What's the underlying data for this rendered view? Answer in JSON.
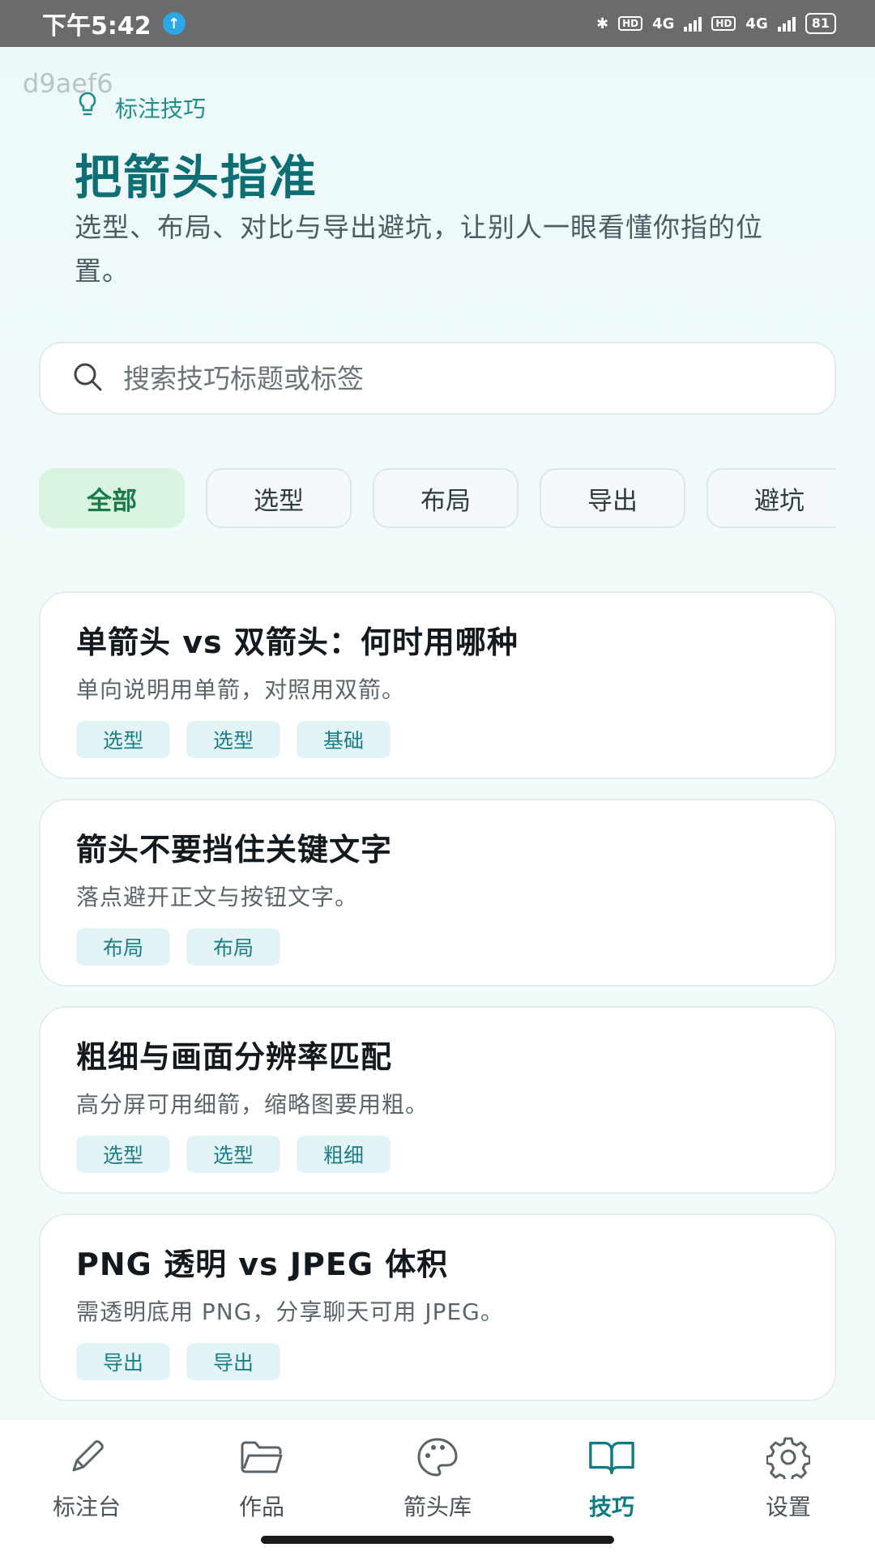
{
  "status_bar": {
    "time": "下午5:42",
    "network_1": "4G",
    "network_2": "4G",
    "hd_label": "HD",
    "battery": "81"
  },
  "watermark": "d9aef6",
  "header": {
    "section_label": "标注技巧",
    "title": "把箭头指准",
    "subtitle": "选型、布局、对比与导出避坑，让别人一眼看懂你指的位置。"
  },
  "search": {
    "placeholder": "搜索技巧标题或标签"
  },
  "filters": [
    {
      "label": "全部",
      "active": true
    },
    {
      "label": "选型",
      "active": false
    },
    {
      "label": "布局",
      "active": false
    },
    {
      "label": "导出",
      "active": false
    },
    {
      "label": "避坑",
      "active": false
    }
  ],
  "cards": [
    {
      "title": "单箭头 vs 双箭头：何时用哪种",
      "desc": "单向说明用单箭，对照用双箭。",
      "tags": [
        "选型",
        "选型",
        "基础"
      ]
    },
    {
      "title": "箭头不要挡住关键文字",
      "desc": "落点避开正文与按钮文字。",
      "tags": [
        "布局",
        "布局"
      ]
    },
    {
      "title": "粗细与画面分辨率匹配",
      "desc": "高分屏可用细箭，缩略图要用粗。",
      "tags": [
        "选型",
        "选型",
        "粗细"
      ]
    },
    {
      "title": "PNG 透明 vs JPEG 体积",
      "desc": "需透明底用 PNG，分享聊天可用 JPEG。",
      "tags": [
        "导出",
        "导出"
      ]
    }
  ],
  "nav": [
    {
      "label": "标注台",
      "icon": "pencil-icon",
      "active": false
    },
    {
      "label": "作品",
      "icon": "folder-icon",
      "active": false
    },
    {
      "label": "箭头库",
      "icon": "palette-icon",
      "active": false
    },
    {
      "label": "技巧",
      "icon": "book-icon",
      "active": true
    },
    {
      "label": "设置",
      "icon": "gear-icon",
      "active": false
    }
  ],
  "colors": {
    "accent": "#0e7b82",
    "active_chip_bg": "#d8f3df",
    "tag_bg": "#e2f4f6"
  }
}
